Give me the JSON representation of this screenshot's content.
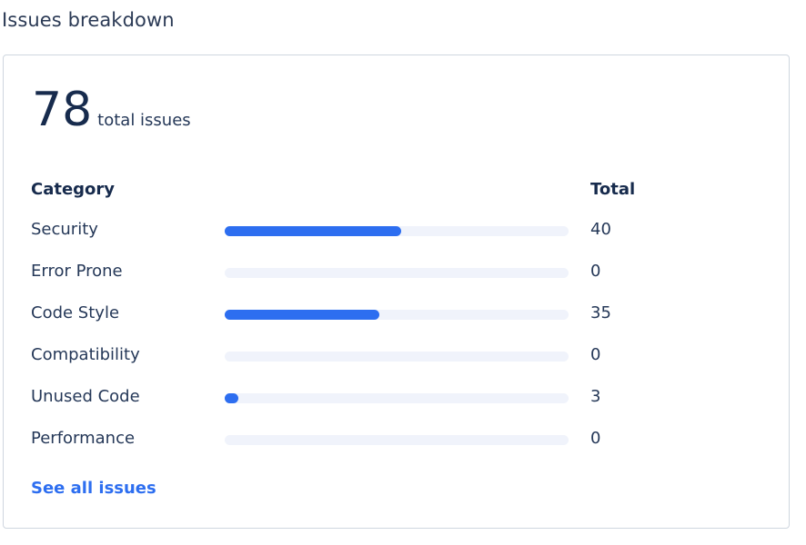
{
  "section": {
    "title": "Issues breakdown"
  },
  "summary": {
    "total": "78",
    "total_label": "total issues"
  },
  "table": {
    "header_category": "Category",
    "header_total": "Total",
    "max_value": 78,
    "rows": [
      {
        "label": "Security",
        "value": 40,
        "value_text": "40"
      },
      {
        "label": "Error Prone",
        "value": 0,
        "value_text": "0"
      },
      {
        "label": "Code Style",
        "value": 35,
        "value_text": "35"
      },
      {
        "label": "Compatibility",
        "value": 0,
        "value_text": "0"
      },
      {
        "label": "Unused Code",
        "value": 3,
        "value_text": "3"
      },
      {
        "label": "Performance",
        "value": 0,
        "value_text": "0"
      }
    ]
  },
  "footer": {
    "link_label": "See all issues"
  },
  "colors": {
    "accent": "#2d6ef0",
    "track": "#f0f3fb",
    "text": "#253858"
  }
}
